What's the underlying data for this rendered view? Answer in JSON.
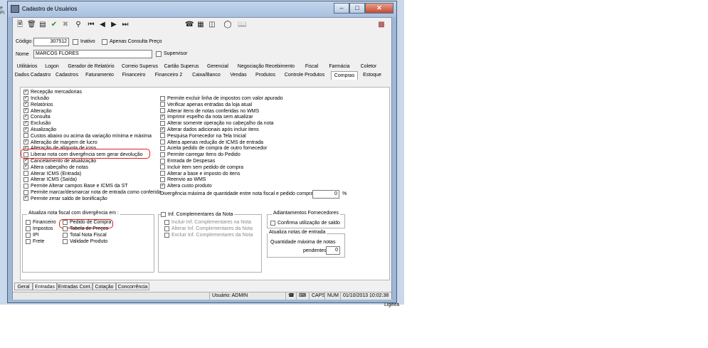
{
  "window": {
    "title": "Cadastro de Usuários"
  },
  "background": {
    "tab_fragment": "e Pi",
    "bottom_fragment": "Ligeira"
  },
  "form": {
    "codigo_label": "Código:",
    "codigo_value": "307512",
    "inativo_label": "Inativo",
    "apenas_consulta_label": "Apenas Consulta Preço",
    "nome_label": "Nome",
    "nome_value": "MARCOS FLORES",
    "supervisor_label": "Supervisor"
  },
  "tabs_row1": [
    "Utilitários",
    "Logon",
    "Gerador de Relatório",
    "Correio Superus",
    "Cartão Superus",
    "Gerencial",
    "Negociação Recebimento",
    "Fiscal",
    "Farmácia",
    "Coletor"
  ],
  "tabs_row2": [
    "Dados Cadastro",
    "Cadastros",
    "Faturamento",
    "Financeiro",
    "Financeiro 2",
    "Caixa/Banco",
    "Vendas",
    "Produtos",
    "Controle Produtos",
    "Compras",
    "Estoque"
  ],
  "active_tab": "Compras",
  "recepcao": {
    "label": "Recepção mercadorias",
    "checked": true
  },
  "left_column": [
    {
      "label": "Inclusão",
      "checked": true
    },
    {
      "label": "Relatórios",
      "checked": true
    },
    {
      "label": "Alteração",
      "checked": true
    },
    {
      "label": "Consulta",
      "checked": true
    },
    {
      "label": "Exclusão",
      "checked": true
    },
    {
      "label": "Atualização",
      "checked": true
    },
    {
      "label": "Custos abaixo ou acima da variação mínima e máxima",
      "checked": false
    },
    {
      "label": "Alteração de margem de lucro",
      "checked": true
    },
    {
      "label": "Alteração de alíquota de icms",
      "checked": true
    },
    {
      "label": "Liberar nota com divergência sem gerar devolução",
      "checked": false
    },
    {
      "label": "Cancelamento de atualização",
      "checked": true
    },
    {
      "label": "Altera cabeçalho de notas",
      "checked": true
    },
    {
      "label": "Alterar ICMS (Entrada)",
      "checked": false
    },
    {
      "label": "Alterar ICMS (Saída)",
      "checked": false
    },
    {
      "label": "Permite Alterar campos Base e ICMS da ST",
      "checked": false
    },
    {
      "label": "Permite marcar/desmarcar nota de entrada como conferida",
      "checked": false
    },
    {
      "label": "Permite zerar saldo de bonificação",
      "checked": true
    }
  ],
  "right_column": [
    {
      "label": "Permite excluir linha de impostos com valor apurado",
      "checked": false
    },
    {
      "label": "Verificar apenas entradas da loja atual",
      "checked": false
    },
    {
      "label": "Alterar itens de notas conferidas no WMS",
      "checked": false
    },
    {
      "label": "Imprimir espelho da nota sem atualizar",
      "checked": true
    },
    {
      "label": "Alterar somente operação no cabeçalho da nota",
      "checked": false
    },
    {
      "label": "Alterar dados adicionais após incluir itens",
      "checked": true
    },
    {
      "label": "Pesquisa Fornecedor na Tela Inicial",
      "checked": false
    },
    {
      "label": "Altera apenas redução de ICMS de entrada",
      "checked": false
    },
    {
      "label": "Aceita pedido de compra de outro fornecedor",
      "checked": false
    },
    {
      "label": "Permite carregar Itens do Pedido",
      "checked": false
    },
    {
      "label": "Entrada de Despesas",
      "checked": false
    },
    {
      "label": "Incluir item sem pedido de compra",
      "checked": false
    },
    {
      "label": "Alterar a base e imposto do itens",
      "checked": false
    },
    {
      "label": "Reenvio ao WMS",
      "checked": false
    },
    {
      "label": "Altera custo produto",
      "checked": true
    }
  ],
  "divergencia": {
    "label": "Divergência máxima de quantidade entre nota fiscal e pedido compra:",
    "value": "0",
    "unit": "%"
  },
  "atualiza_group": {
    "title": "Atualiza nota fiscal com divergência em :",
    "col1": [
      "Financeiro",
      "Impostos",
      "IPI",
      "Frete"
    ],
    "col2": [
      "Pedido de Compra",
      "Tabela de Preços",
      "Total Nota Fiscal",
      "Validade Produto"
    ]
  },
  "inf_group": {
    "title": "Inf. Complementares da Nota",
    "items": [
      "Incluir Inf. Complementares na Nota",
      "Alterar Inf. Complementares da Nota",
      "Excluir Inf. Complementares da Nota"
    ]
  },
  "adiant_group": {
    "title": "Adiantamentos Fornecedores",
    "item": "Confirma utilização de saldo"
  },
  "atualiza_notas_group": {
    "title": "Atualiza notas de entrada",
    "line1": "Quantidade máxima de notas",
    "line2": "pendentes:",
    "value": "0"
  },
  "bottom_tabs": [
    "Geral",
    "Entradas",
    "Entradas Cont.",
    "Cotação",
    "Concorrência"
  ],
  "active_bottom_tab": "Entradas",
  "statusbar": {
    "usuario": "Usuário: ADMIN",
    "caps": "CAPS",
    "num": "NUM",
    "datetime": "01/10/2013 10:02:38"
  },
  "colors": {
    "title_bg": "#a8c0df",
    "close_btn": "#c44b31",
    "highlight": "#e02020"
  }
}
